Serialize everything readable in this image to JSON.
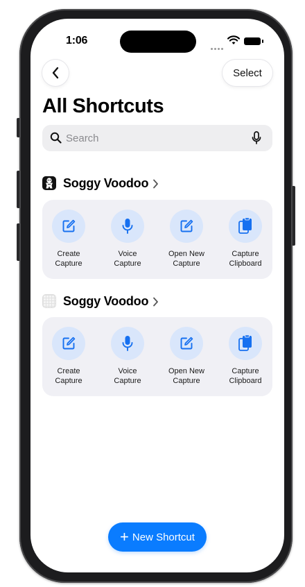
{
  "status_bar": {
    "time": "1:06"
  },
  "nav": {
    "select_label": "Select"
  },
  "page": {
    "title": "All Shortcuts"
  },
  "search": {
    "placeholder": "Search",
    "value": ""
  },
  "sections": [
    {
      "title": "Soggy Voodoo",
      "actions": [
        {
          "label": "Create\nCapture",
          "icon": "compose-icon"
        },
        {
          "label": "Voice\nCapture",
          "icon": "mic-icon"
        },
        {
          "label": "Open New\nCapture",
          "icon": "compose-icon"
        },
        {
          "label": "Capture\nClipboard",
          "icon": "clipboard-icon"
        }
      ]
    },
    {
      "title": "Soggy Voodoo",
      "actions": [
        {
          "label": "Create\nCapture",
          "icon": "compose-icon"
        },
        {
          "label": "Voice\nCapture",
          "icon": "mic-icon"
        },
        {
          "label": "Open New\nCapture",
          "icon": "compose-icon"
        },
        {
          "label": "Capture\nClipboard",
          "icon": "clipboard-icon"
        }
      ]
    }
  ],
  "new_shortcut_button": {
    "label": "New Shortcut"
  },
  "colors": {
    "accent": "#0a7cff",
    "action_circle": "#d9e6fb",
    "card_bg": "#f0f0f5"
  }
}
